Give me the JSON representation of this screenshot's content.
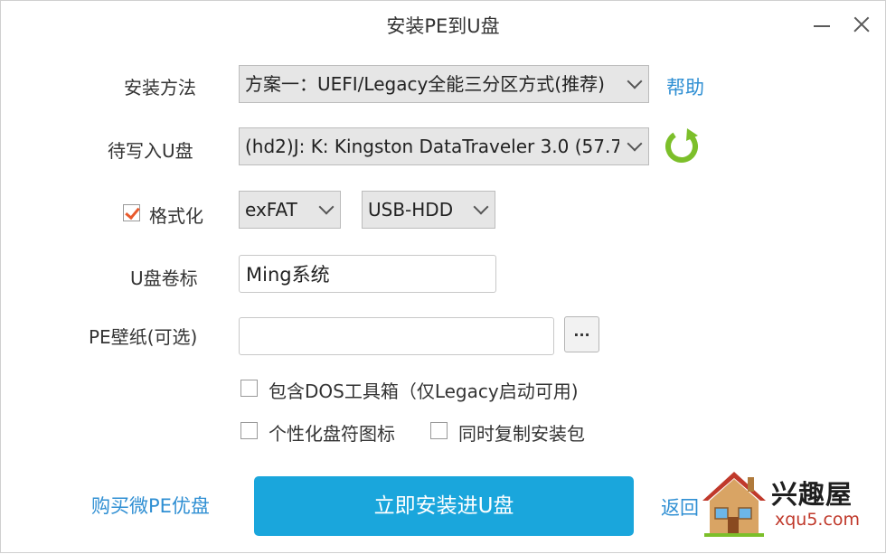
{
  "window": {
    "title": "安装PE到U盘"
  },
  "install_method": {
    "label": "安装方法",
    "value": "方案一：UEFI/Legacy全能三分区方式(推荐)",
    "help_link": "帮助"
  },
  "target_drive": {
    "label": "待写入U盘",
    "value": "(hd2)J: K: Kingston DataTraveler 3.0 (57.7"
  },
  "format": {
    "label": "格式化",
    "checked": true,
    "filesystem": "exFAT",
    "mode": "USB-HDD"
  },
  "volume_label": {
    "label": "U盘卷标",
    "value": "Ming系统"
  },
  "wallpaper": {
    "label": "PE壁纸(可选)",
    "value": "",
    "browse_label": "..."
  },
  "options": {
    "dos_toolbox": "包含DOS工具箱（仅Legacy启动可用)",
    "custom_icon": "个性化盘符图标",
    "copy_installer": "同时复制安装包"
  },
  "footer": {
    "buy_link": "购买微PE优盘",
    "install_button": "立即安装进U盘",
    "back_link": "返回"
  },
  "watermark": {
    "name": "兴趣屋",
    "url": "xqu5.com"
  },
  "colors": {
    "accent": "#1aa6dc",
    "link": "#2f8fd3",
    "check": "#e8592c",
    "refresh": "#7cbf2a"
  }
}
